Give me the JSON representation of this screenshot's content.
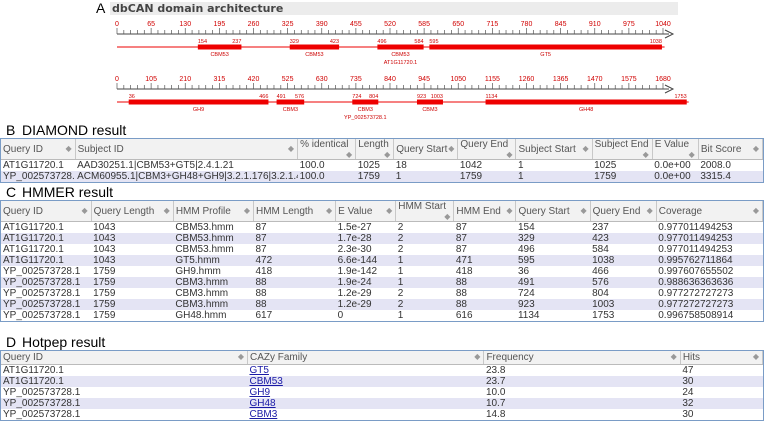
{
  "panel_a": {
    "letter": "A",
    "title": "dbCAN domain architecture",
    "seq1": {
      "ticks": [
        "0",
        "65",
        "130",
        "195",
        "260",
        "325",
        "390",
        "455",
        "520",
        "585",
        "650",
        "715",
        "780",
        "845",
        "910",
        "975",
        "1040"
      ],
      "domains": [
        {
          "name": "CBM53",
          "start": "154",
          "end": "237",
          "s": 154,
          "e": 237
        },
        {
          "name": "CBM53",
          "start": "329",
          "end": "423",
          "s": 329,
          "e": 423
        },
        {
          "name": "CBM53",
          "start": "496",
          "end": "584",
          "s": 496,
          "e": 584
        },
        {
          "name": "GT5",
          "start": "595",
          "end": "1038",
          "s": 595,
          "e": 1038
        }
      ],
      "id": "AT1G11720.1",
      "length": 1043
    },
    "seq2": {
      "ticks": [
        "0",
        "105",
        "210",
        "315",
        "420",
        "525",
        "630",
        "735",
        "840",
        "945",
        "1050",
        "1155",
        "1260",
        "1365",
        "1470",
        "1575",
        "1680"
      ],
      "domains": [
        {
          "name": "GH9",
          "start": "36",
          "end": "466",
          "s": 36,
          "e": 466
        },
        {
          "name": "CBM3",
          "start": "491",
          "end": "576",
          "s": 491,
          "e": 576
        },
        {
          "name": "CBM3",
          "start": "724",
          "end": "804",
          "s": 724,
          "e": 804
        },
        {
          "name": "CBM3",
          "start": "923",
          "end": "1003",
          "s": 923,
          "e": 1003
        },
        {
          "name": "GH48",
          "start": "1134",
          "end": "1753",
          "s": 1134,
          "e": 1753
        }
      ],
      "id": "YP_002573728.1",
      "length": 1759
    }
  },
  "panel_b": {
    "letter": "B",
    "title": "DIAMOND result",
    "headers": [
      "Query ID",
      "Subject ID",
      "% identical",
      "Length",
      "Query Start",
      "Query End",
      "Subject Start",
      "Subject End",
      "E Value",
      "Bit Score"
    ],
    "rows": [
      [
        "AT1G11720.1",
        "AAD30251.1|CBM53+GT5|2.4.1.21",
        "100.0",
        "1025",
        "18",
        "1042",
        "1",
        "1025",
        "0.0e+00",
        "2008.0"
      ],
      [
        "YP_002573728.1",
        "ACM60955.1|CBM3+GH48+GH9|3.2.1.176|3.2.1.4",
        "100.0",
        "1759",
        "1",
        "1759",
        "1",
        "1759",
        "0.0e+00",
        "3315.4"
      ]
    ]
  },
  "panel_c": {
    "letter": "C",
    "title": "HMMER result",
    "headers": [
      "Query ID",
      "Query Length",
      "HMM Profile",
      "HMM Length",
      "E Value",
      "HMM Start",
      "HMM End",
      "Query Start",
      "Query End",
      "Coverage"
    ],
    "rows": [
      [
        "AT1G11720.1",
        "1043",
        "CBM53.hmm",
        "87",
        "1.5e-27",
        "2",
        "87",
        "154",
        "237",
        "0.977011494253"
      ],
      [
        "AT1G11720.1",
        "1043",
        "CBM53.hmm",
        "87",
        "1.7e-28",
        "2",
        "87",
        "329",
        "423",
        "0.977011494253"
      ],
      [
        "AT1G11720.1",
        "1043",
        "CBM53.hmm",
        "87",
        "2.3e-30",
        "2",
        "87",
        "496",
        "584",
        "0.977011494253"
      ],
      [
        "AT1G11720.1",
        "1043",
        "GT5.hmm",
        "472",
        "6.6e-144",
        "1",
        "471",
        "595",
        "1038",
        "0.995762711864"
      ],
      [
        "YP_002573728.1",
        "1759",
        "GH9.hmm",
        "418",
        "1.9e-142",
        "1",
        "418",
        "36",
        "466",
        "0.997607655502"
      ],
      [
        "YP_002573728.1",
        "1759",
        "CBM3.hmm",
        "88",
        "1.9e-24",
        "1",
        "88",
        "491",
        "576",
        "0.988636363636"
      ],
      [
        "YP_002573728.1",
        "1759",
        "CBM3.hmm",
        "88",
        "1.2e-29",
        "2",
        "88",
        "724",
        "804",
        "0.977272727273"
      ],
      [
        "YP_002573728.1",
        "1759",
        "CBM3.hmm",
        "88",
        "1.2e-29",
        "2",
        "88",
        "923",
        "1003",
        "0.977272727273"
      ],
      [
        "YP_002573728.1",
        "1759",
        "GH48.hmm",
        "617",
        "0",
        "1",
        "616",
        "1134",
        "1753",
        "0.996758508914"
      ]
    ]
  },
  "panel_d": {
    "letter": "D",
    "title": "Hotpep result",
    "headers": [
      "Query ID",
      "CAZy Family",
      "Frequency",
      "Hits"
    ],
    "rows": [
      [
        "AT1G11720.1",
        "GT5",
        "23.8",
        "47"
      ],
      [
        "AT1G11720.1",
        "CBM53",
        "23.7",
        "30"
      ],
      [
        "YP_002573728.1",
        "GH9",
        "10.0",
        "24"
      ],
      [
        "YP_002573728.1",
        "GH48",
        "10.7",
        "32"
      ],
      [
        "YP_002573728.1",
        "CBM3",
        "14.8",
        "30"
      ]
    ]
  },
  "colors": {
    "domain": "#ee0000",
    "header_bg": "#f2f2f2",
    "row_alt": "#e4e4f4",
    "border": "#7a9cc6",
    "link": "#1a1aa6"
  }
}
